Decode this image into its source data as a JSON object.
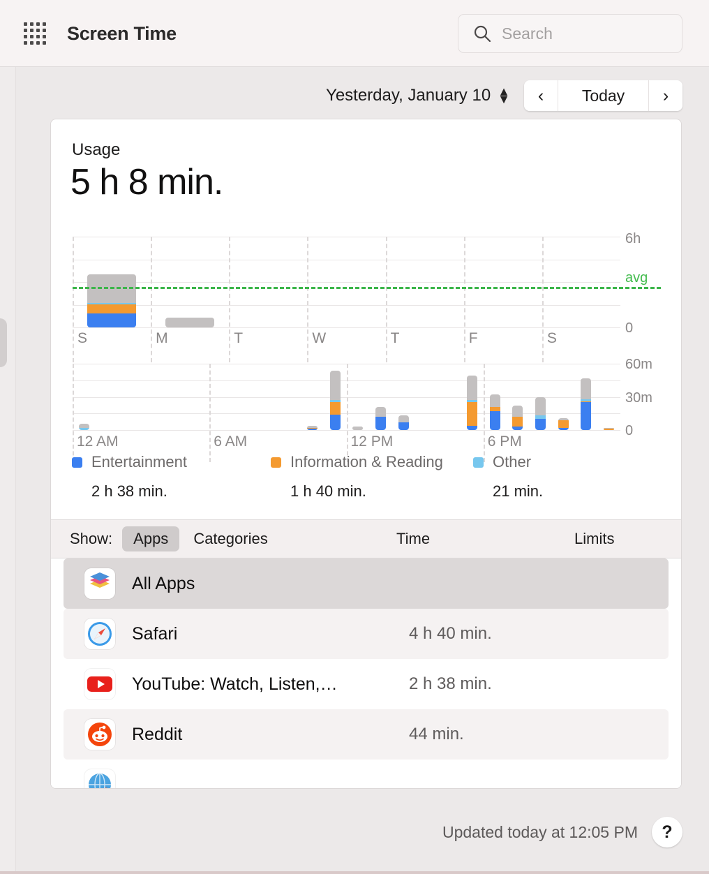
{
  "header": {
    "grid_icon": "apps-grid-icon",
    "title": "Screen Time",
    "search_icon": "search-icon",
    "search_placeholder": "Search",
    "search_value": ""
  },
  "datenav": {
    "date_label": "Yesterday, January 10",
    "stepper_icon": "stepper-up-down-icon",
    "prev_label": "‹",
    "today_label": "Today",
    "next_label": "›"
  },
  "usage": {
    "label": "Usage",
    "value": "5 h 8 min."
  },
  "legend": [
    {
      "name": "Entertainment",
      "color": "#3b7ff0",
      "value": "2 h 38 min."
    },
    {
      "name": "Information & Reading",
      "color": "#f49a30",
      "value": "1 h 40 min."
    },
    {
      "name": "Other",
      "color": "#77c7ee",
      "value": "21 min."
    }
  ],
  "showbar": {
    "label": "Show:",
    "apps_label": "Apps",
    "categories_label": "Categories",
    "time_label": "Time",
    "limits_label": "Limits"
  },
  "apps": [
    {
      "name": "All Apps",
      "time": "",
      "icon": "all-apps-icon",
      "selected": true
    },
    {
      "name": "Safari",
      "time": "4 h 40 min.",
      "icon": "safari-icon",
      "selected": false
    },
    {
      "name": "YouTube: Watch, Listen,…",
      "time": "2 h 38 min.",
      "icon": "youtube-icon",
      "selected": false
    },
    {
      "name": "Reddit",
      "time": "44 min.",
      "icon": "reddit-icon",
      "selected": false
    },
    {
      "name": "",
      "time": "",
      "icon": "globe-icon",
      "selected": false
    }
  ],
  "footer": {
    "updated": "Updated today at 12:05 PM",
    "help_label": "?"
  },
  "chart_data": [
    {
      "id": "weekly",
      "type": "bar",
      "stacked": true,
      "title": "",
      "xlabel": "",
      "ylabel": "",
      "categories": [
        "S",
        "M",
        "T",
        "W",
        "T",
        "F",
        "S"
      ],
      "ylim": [
        0,
        6
      ],
      "ytick_labels": [
        "6h",
        "0"
      ],
      "yticks": [
        6,
        0
      ],
      "unit": "hours",
      "grid": true,
      "average": {
        "value": 2.55,
        "label": "avg",
        "color": "#3cb54a",
        "style": "dashed"
      },
      "series": [
        {
          "name": "Entertainment",
          "color": "#3b7ff0",
          "values": [
            0.92,
            0,
            0,
            0,
            0,
            0,
            0
          ]
        },
        {
          "name": "Information & Reading",
          "color": "#f49a30",
          "values": [
            0.62,
            0,
            0,
            0,
            0,
            0,
            0
          ]
        },
        {
          "name": "Other",
          "color": "#77c7ee",
          "values": [
            0.1,
            0,
            0,
            0,
            0,
            0,
            0
          ]
        },
        {
          "name": "Unclassified",
          "color": "#c3c0c0",
          "values": [
            1.86,
            0.66,
            0,
            0,
            0,
            0,
            0
          ]
        }
      ],
      "totals": [
        3.5,
        0.66,
        0,
        0,
        0,
        0,
        0
      ]
    },
    {
      "id": "hourly",
      "type": "bar",
      "stacked": true,
      "title": "",
      "xlabel": "",
      "ylabel": "",
      "categories": [
        "12 AM",
        "1 AM",
        "2 AM",
        "3 AM",
        "4 AM",
        "5 AM",
        "6 AM",
        "7 AM",
        "8 AM",
        "9 AM",
        "10 AM",
        "11 AM",
        "12 PM",
        "1 PM",
        "2 PM",
        "3 PM",
        "4 PM",
        "5 PM",
        "6 PM",
        "7 PM",
        "8 PM",
        "9 PM",
        "10 PM",
        "11 PM"
      ],
      "xtick_labels": [
        "12 AM",
        "6 AM",
        "12 PM",
        "6 PM"
      ],
      "ylim": [
        0,
        60
      ],
      "ytick_labels": [
        "60m",
        "30m",
        "0"
      ],
      "yticks": [
        60,
        30,
        0
      ],
      "unit": "minutes",
      "grid": true,
      "series": [
        {
          "name": "Entertainment",
          "color": "#3b7ff0",
          "values": [
            0,
            0,
            0,
            0,
            0,
            0,
            0,
            0,
            0,
            0,
            1,
            14,
            0,
            12,
            7,
            0,
            0,
            4,
            17,
            3,
            10,
            2,
            25,
            0
          ]
        },
        {
          "name": "Information & Reading",
          "color": "#f49a30",
          "values": [
            0,
            0,
            0,
            0,
            0,
            0,
            0,
            0,
            0,
            0,
            1,
            11,
            0,
            0,
            0,
            0,
            0,
            21,
            4,
            9,
            0,
            7,
            1,
            1
          ]
        },
        {
          "name": "Other",
          "color": "#77c7ee",
          "values": [
            2,
            0,
            0,
            0,
            0,
            0,
            0,
            0,
            0,
            0,
            0,
            2,
            0,
            0,
            0,
            0,
            0,
            2,
            0,
            0,
            3,
            0,
            2,
            0
          ]
        },
        {
          "name": "Unclassified",
          "color": "#c3c0c0",
          "values": [
            4,
            0,
            0,
            0,
            0,
            0,
            0,
            0,
            0,
            0,
            2,
            27,
            3,
            9,
            6,
            0,
            0,
            22,
            11,
            10,
            17,
            2,
            19,
            1
          ]
        }
      ],
      "totals": [
        6,
        0,
        0,
        0,
        0,
        0,
        0,
        0,
        0,
        0,
        4,
        54,
        3,
        21,
        13,
        0,
        0,
        49,
        32,
        22,
        30,
        11,
        47,
        2
      ]
    }
  ]
}
